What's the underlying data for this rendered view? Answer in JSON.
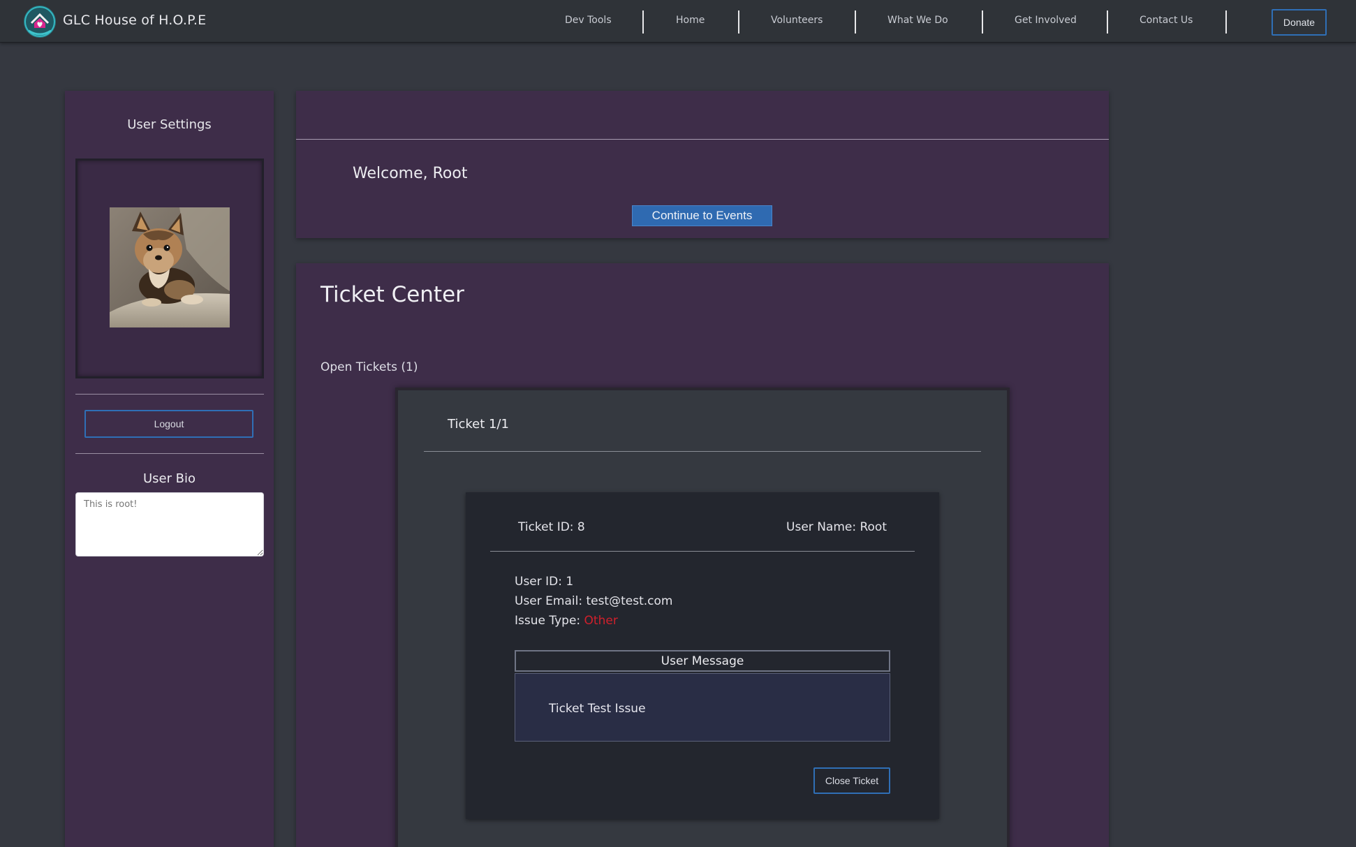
{
  "brand": {
    "name": "GLC House of H.O.P.E",
    "logo_icon": "house-heart-logo-icon"
  },
  "nav": {
    "links": [
      "Dev Tools",
      "Home",
      "Volunteers",
      "What We Do",
      "Get Involved",
      "Contact Us"
    ],
    "donate_label": "Donate"
  },
  "sidebar": {
    "title": "User Settings",
    "avatar": "dog-photo",
    "logout_label": "Logout",
    "bio_label": "User Bio",
    "bio_placeholder": "This is root!"
  },
  "welcome": {
    "text": "Welcome, Root",
    "button_label": "Continue to Events"
  },
  "ticket_center": {
    "title": "Ticket Center",
    "open_label": "Open Tickets (1)",
    "ticket": {
      "header": "Ticket 1/1",
      "ticket_id": "Ticket ID: 8",
      "user_name": "User Name: Root",
      "user_id": "User ID: 1",
      "user_email": "User Email: test@test.com",
      "issue_type_label": "Issue Type:",
      "issue_type_value": "Other",
      "message_header": "User Message",
      "message_body": "Ticket Test Issue",
      "close_label": "Close Ticket"
    }
  },
  "colors": {
    "background": "#353840",
    "navbar": "#2f3338",
    "panel": "#3e2d49",
    "accent_blue": "#2f6fb6",
    "issue_red": "#d0202c"
  }
}
